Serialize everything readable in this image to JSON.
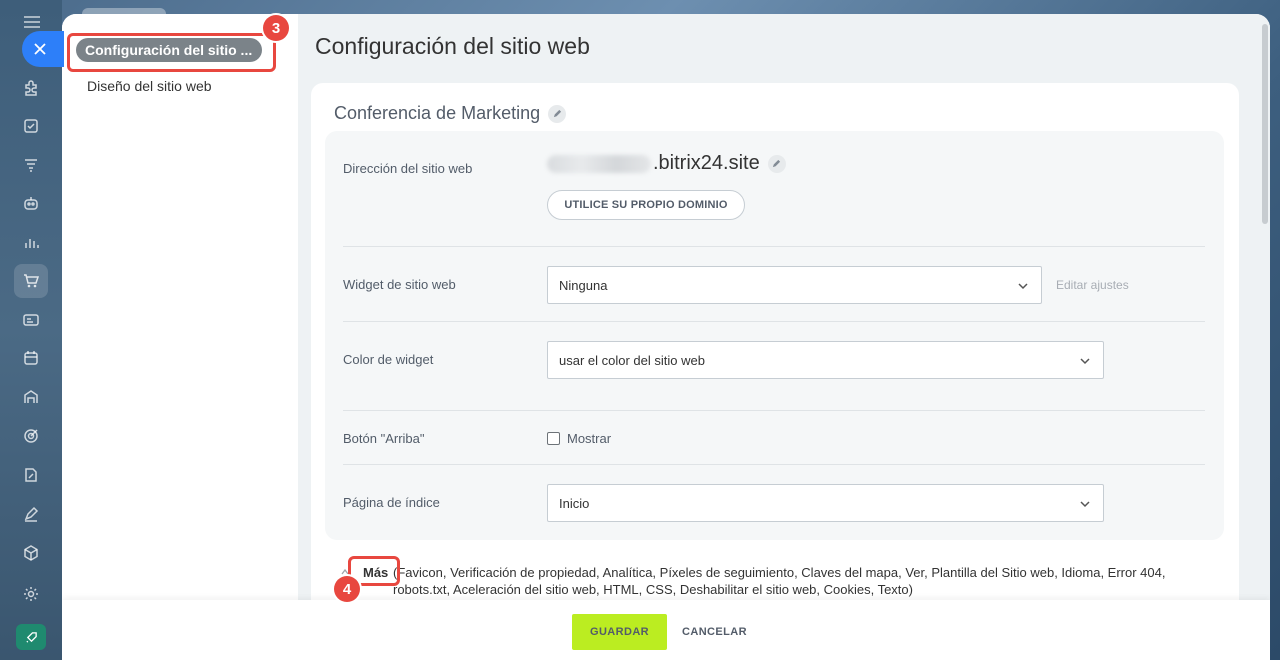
{
  "sidebar_nav": {
    "items": [
      {
        "icon": "puzzle-icon"
      },
      {
        "icon": "task-check-icon"
      },
      {
        "icon": "funnel-icon"
      },
      {
        "icon": "robot-icon"
      },
      {
        "icon": "bar-chart-icon"
      },
      {
        "icon": "cart-icon"
      },
      {
        "icon": "contact-card-icon"
      },
      {
        "icon": "calendar-icon"
      },
      {
        "icon": "warehouse-icon"
      },
      {
        "icon": "target-icon"
      },
      {
        "icon": "document-sign-icon"
      },
      {
        "icon": "pen-icon"
      },
      {
        "icon": "cube-icon"
      },
      {
        "icon": "gear-icon"
      }
    ]
  },
  "slider": {
    "side_menu": {
      "active_item": "Configuración del sitio ...",
      "items": [
        "Diseño del sitio web"
      ]
    },
    "page_title": "Configuración del sitio web",
    "site_name": "Conferencia de Marketing",
    "domain": {
      "label": "Dirección del sitio web",
      "suffix": ".bitrix24.site",
      "button": "UTILICE SU PROPIO DOMINIO"
    },
    "widget": {
      "label": "Widget de sitio web",
      "value": "Ninguna",
      "edit_link": "Editar ajustes"
    },
    "widget_color": {
      "label": "Color de widget",
      "value": "usar el color del sitio web"
    },
    "up_button": {
      "label": "Botón \"Arriba\"",
      "checkbox_label": "Mostrar",
      "checked": false
    },
    "index_page": {
      "label": "Página de índice",
      "value": "Inicio"
    },
    "more": {
      "label": "Más",
      "text": "(Favicon,  Verificación de propiedad,  Analítica,  Píxeles de seguimiento,  Claves del mapa,  Ver,  Plantilla del Sitio web,  Idioma,  Error 404,  robots.txt,  Aceleración del sitio web,  HTML,  CSS,  Deshabilitar el sitio web,  Cookies,  Texto)"
    },
    "footer": {
      "save": "GUARDAR",
      "cancel": "CANCELAR"
    }
  },
  "annotations": {
    "step_side": "3",
    "step_more": "4",
    "color": "#e8473f"
  },
  "colors": {
    "accent_blue": "#2d7ff9",
    "save_green": "#bbed21"
  }
}
